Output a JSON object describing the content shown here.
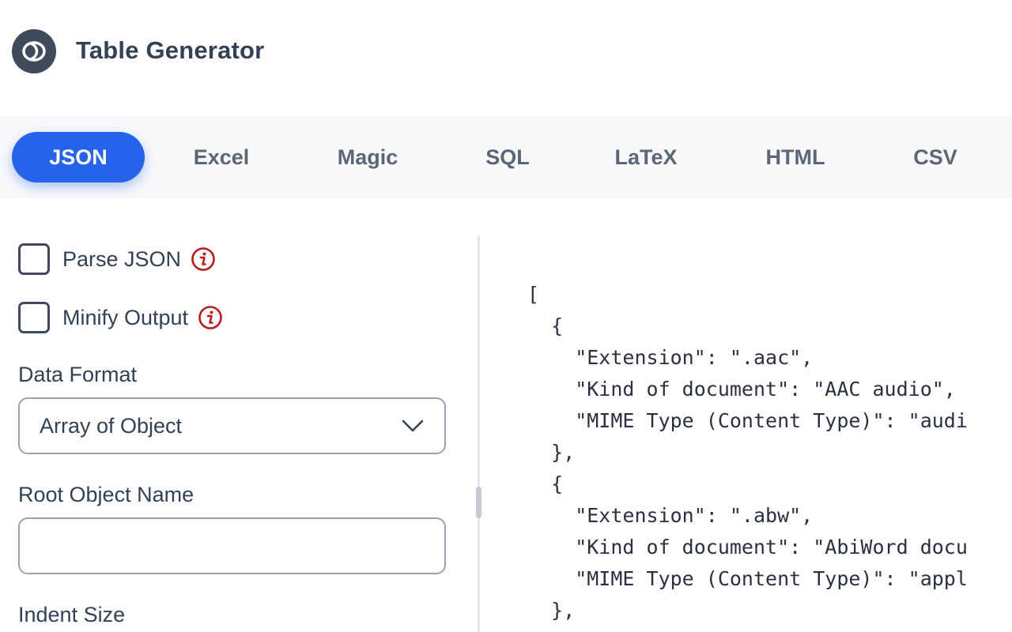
{
  "header": {
    "title": "Table Generator",
    "logo_icon": "logo-icon"
  },
  "tabs": [
    {
      "label": "JSON",
      "active": true
    },
    {
      "label": "Excel",
      "active": false
    },
    {
      "label": "Magic",
      "active": false
    },
    {
      "label": "SQL",
      "active": false
    },
    {
      "label": "LaTeX",
      "active": false
    },
    {
      "label": "HTML",
      "active": false
    },
    {
      "label": "CSV",
      "active": false
    }
  ],
  "options": {
    "parse_json": {
      "label": "Parse JSON",
      "checked": false,
      "info_icon": "info-icon"
    },
    "minify_output": {
      "label": "Minify Output",
      "checked": false,
      "info_icon": "info-icon"
    }
  },
  "data_format": {
    "label": "Data Format",
    "selected": "Array of Object",
    "icon": "chevron-down-icon"
  },
  "root_object_name": {
    "label": "Root Object Name",
    "value": "",
    "placeholder": ""
  },
  "indent_size": {
    "label": "Indent Size"
  },
  "output": {
    "lines": [
      "[",
      "  {",
      "    \"Extension\": \".aac\",",
      "    \"Kind of document\": \"AAC audio\",",
      "    \"MIME Type (Content Type)\": \"audi",
      "  },",
      "  {",
      "    \"Extension\": \".abw\",",
      "    \"Kind of document\": \"AbiWord docu",
      "    \"MIME Type (Content Type)\": \"appl",
      "  },"
    ]
  },
  "colors": {
    "accent": "#2563eb",
    "info": "#b91c1c",
    "text": "#334155"
  }
}
